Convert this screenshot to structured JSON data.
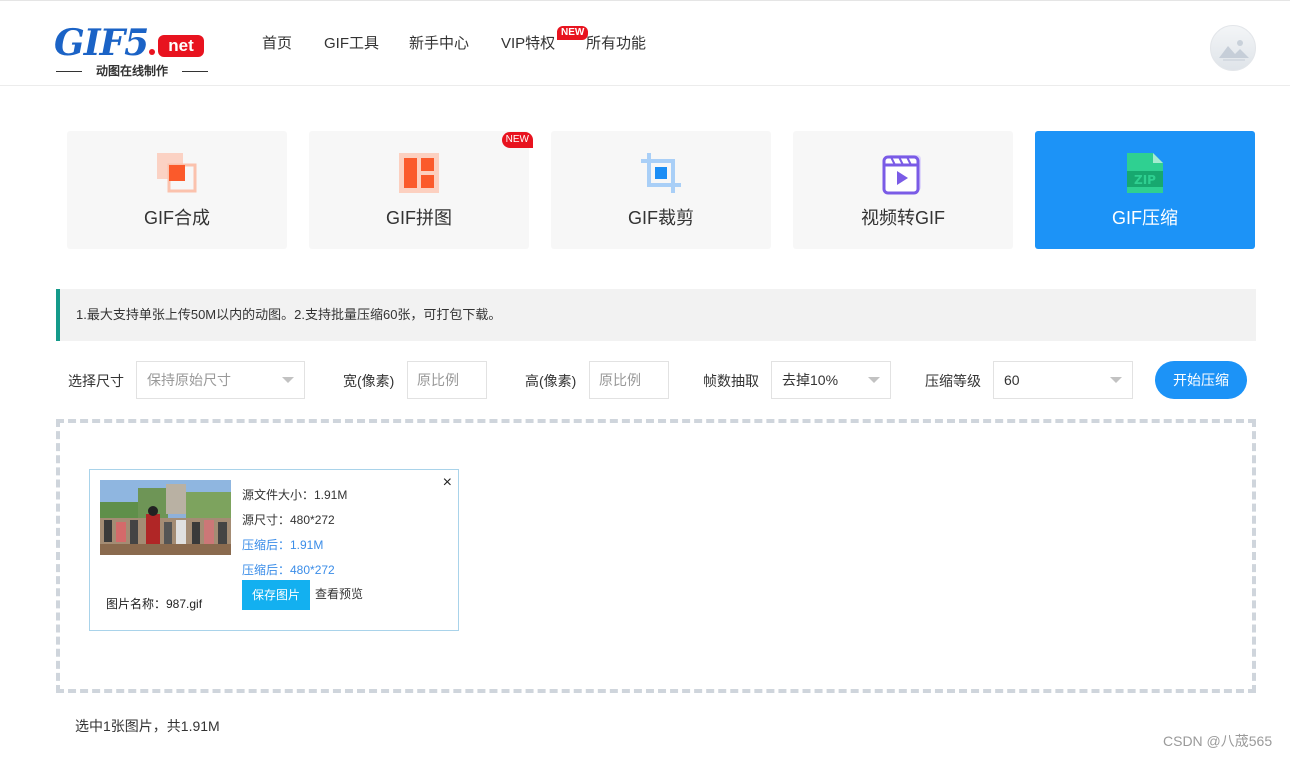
{
  "logo": {
    "brand": "GIF5",
    "tld": "net",
    "tagline": "动图在线制作"
  },
  "nav": {
    "items": [
      {
        "label": "首页"
      },
      {
        "label": "GIF工具"
      },
      {
        "label": "新手中心"
      },
      {
        "label": "VIP特权",
        "badge": "NEW"
      },
      {
        "label": "所有功能"
      }
    ]
  },
  "tools": [
    {
      "label": "GIF合成",
      "icon": "merge-icon",
      "active": false
    },
    {
      "label": "GIF拼图",
      "icon": "collage-icon",
      "badge": "NEW",
      "active": false
    },
    {
      "label": "GIF裁剪",
      "icon": "crop-icon",
      "active": false
    },
    {
      "label": "视频转GIF",
      "icon": "video-icon",
      "active": false
    },
    {
      "label": "GIF压缩",
      "icon": "zip-icon",
      "active": true
    }
  ],
  "notice": "1.最大支持单张上传50M以内的动图。2.支持批量压缩60张，可打包下载。",
  "options": {
    "size_label": "选择尺寸",
    "size_value": "保持原始尺寸",
    "width_label": "宽(像素)",
    "width_placeholder": "原比例",
    "height_label": "高(像素)",
    "height_placeholder": "原比例",
    "frames_label": "帧数抽取",
    "frames_value": "去掉10%",
    "level_label": "压缩等级",
    "level_value": "60",
    "start_button": "开始压缩"
  },
  "file_card": {
    "src_size": "源文件大小：1.91M",
    "src_dim": "源尺寸：480*272",
    "out_size": "压缩后：1.91M",
    "out_dim": "压缩后：480*272",
    "save_button": "保存图片",
    "preview_link": "查看预览",
    "file_name": "图片名称：987.gif",
    "close": "×"
  },
  "summary": "选中1张图片，共1.91M",
  "watermark": "CSDN @八荿565",
  "colors": {
    "primary": "#1c93f7",
    "logo_blue": "#1b63c6",
    "logo_red": "#e8131f",
    "notice_bar": "#159a8a",
    "save_btn": "#13b0f0"
  }
}
